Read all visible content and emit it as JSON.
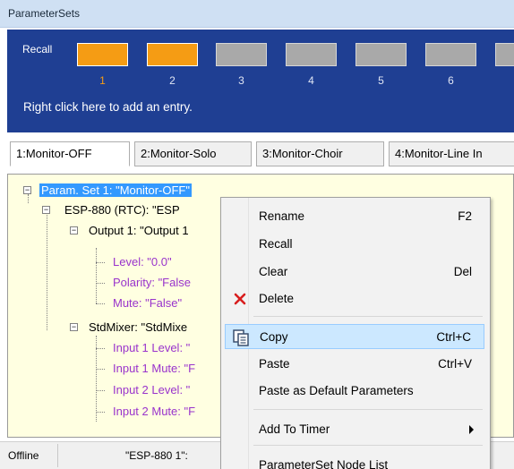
{
  "window": {
    "title": "ParameterSets"
  },
  "recall": {
    "label": "Recall",
    "slots": [
      {
        "number": "1",
        "active": true
      },
      {
        "number": "2",
        "active": true
      },
      {
        "number": "3",
        "active": false
      },
      {
        "number": "4",
        "active": false
      },
      {
        "number": "5",
        "active": false
      },
      {
        "number": "6",
        "active": false
      },
      {
        "number": "",
        "active": false
      }
    ],
    "hint": "Right click here to add an entry.",
    "colors": {
      "panel": "#1f3f93",
      "active_slot": "#f59c14",
      "inactive_slot": "#a9a9a9"
    }
  },
  "tabs": [
    {
      "label": "1:Monitor-OFF",
      "selected": true
    },
    {
      "label": "2:Monitor-Solo",
      "selected": false
    },
    {
      "label": "3:Monitor-Choir",
      "selected": false
    },
    {
      "label": "4:Monitor-Line In",
      "selected": false
    }
  ],
  "tree": {
    "root": "Param. Set 1: \"Monitor-OFF\"",
    "device": "ESP-880 (RTC): \"ESP",
    "output": "Output 1: \"Output 1",
    "output_params": [
      "Level: \"0.0\"",
      "Polarity: \"False",
      "Mute: \"False\""
    ],
    "mixer": "StdMixer: \"StdMixe",
    "mixer_params": [
      "Input 1 Level: \"",
      "Input 1 Mute: \"F",
      "Input 2 Level: \"",
      "Input 2 Mute: \"F"
    ]
  },
  "context_menu": {
    "items": [
      {
        "label": "Rename",
        "shortcut": "F2"
      },
      {
        "label": "Recall",
        "shortcut": ""
      },
      {
        "label": "Clear",
        "shortcut": "Del"
      },
      {
        "label": "Delete",
        "shortcut": "",
        "icon": "delete-x-icon"
      },
      {
        "label": "Copy",
        "shortcut": "Ctrl+C",
        "icon": "copy-icon",
        "highlighted": true
      },
      {
        "label": "Paste",
        "shortcut": "Ctrl+V"
      },
      {
        "label": "Paste as Default Parameters",
        "shortcut": ""
      },
      {
        "label": "Add To Timer",
        "shortcut": "",
        "submenu": true
      },
      {
        "label": "ParameterSet Node List",
        "shortcut": ""
      }
    ]
  },
  "status": {
    "connection": "Offline",
    "device": "\"ESP-880 1\":"
  }
}
